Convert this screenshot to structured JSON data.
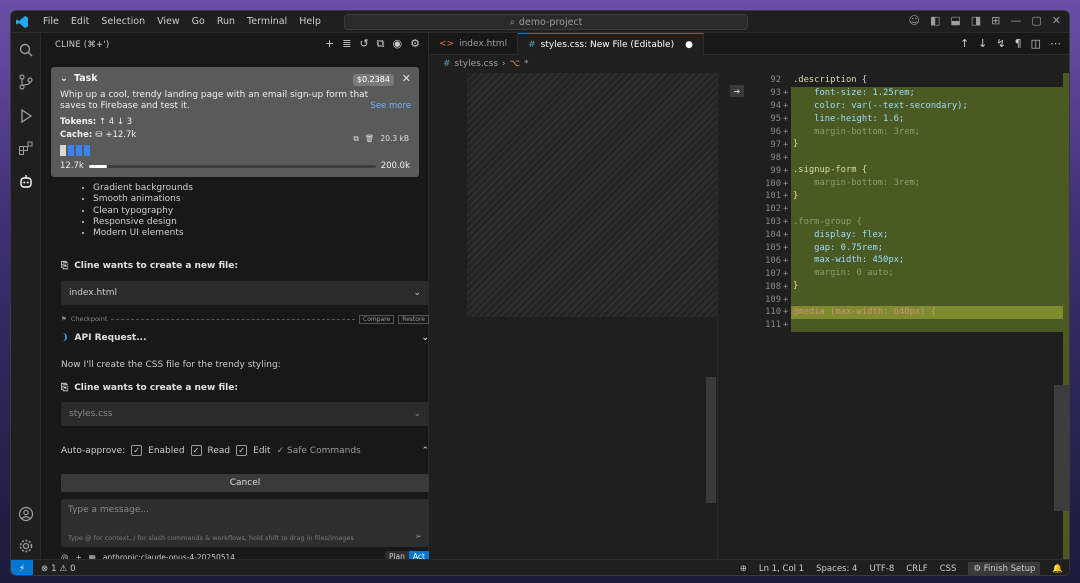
{
  "menu": [
    "File",
    "Edit",
    "Selection",
    "View",
    "Go",
    "Run",
    "Terminal",
    "Help"
  ],
  "search": {
    "text": "demo-project"
  },
  "sidebar": {
    "title": "CLINE (⌘+')"
  },
  "task": {
    "label": "Task",
    "cost": "$0.2384",
    "description": "Whip up a cool, trendy landing page with an email sign-up form that saves to Firebase and test it.",
    "see_more": "See more",
    "tokens_label": "Tokens:",
    "tokens_up": "4",
    "tokens_down": "3",
    "cache_label": "Cache:",
    "cache_value": "+12.7k",
    "cache_size": "20.3 kB",
    "context_used": "12.7k",
    "context_max": "200.0k",
    "context_fraction": 0.0635
  },
  "features": [
    "Gradient backgrounds",
    "Smooth animations",
    "Clean typography",
    "Responsive design",
    "Modern UI elements"
  ],
  "ask1": {
    "label": "Cline wants to create a new file:",
    "file": "index.html"
  },
  "checkpoint": {
    "label": "Checkpoint",
    "compare": "Compare",
    "restore": "Restore"
  },
  "api": {
    "label": "API Request..."
  },
  "now_text": "Now I'll create the CSS file for the trendy styling:",
  "ask2": {
    "label": "Cline wants to create a new file:",
    "file": "styles.css"
  },
  "auto": {
    "label": "Auto-approve:",
    "enabled": "Enabled",
    "read": "Read",
    "edit": "Edit",
    "safe": "✓ Safe Commands"
  },
  "cancel": "Cancel",
  "message": {
    "placeholder": "Type a message...",
    "hint": "Type @ for context, / for slash commands & workflows, hold shift to drag in files/images"
  },
  "footer": {
    "model": "anthropic:claude-opus-4-20250514",
    "plan": "Plan",
    "act": "Act"
  },
  "tabs": [
    {
      "label": "index.html",
      "icon": "<>"
    },
    {
      "label": "styles.css: New File (Editable)",
      "icon": "#"
    }
  ],
  "breadcrumb": {
    "file": "styles.css",
    "symbol": "*"
  },
  "code": [
    {
      "n": "92",
      "t": "sel",
      "c": ".description {",
      "mark": "",
      "kind": ""
    },
    {
      "n": "93",
      "t": "prop",
      "c": "    font-size: 1.25rem;",
      "mark": "+",
      "kind": "add"
    },
    {
      "n": "94",
      "t": "prop",
      "c": "    color: var(--text-secondary);",
      "mark": "+",
      "kind": "add"
    },
    {
      "n": "95",
      "t": "prop",
      "c": "    line-height: 1.6;",
      "mark": "+",
      "kind": "add"
    },
    {
      "n": "96",
      "t": "dim",
      "c": "    margin-bottom: 3rem;",
      "mark": "+",
      "kind": "add"
    },
    {
      "n": "97",
      "t": "sel",
      "c": "}",
      "mark": "+",
      "kind": "add"
    },
    {
      "n": "98",
      "t": "sel",
      "c": "",
      "mark": "+",
      "kind": "add"
    },
    {
      "n": "99",
      "t": "sel",
      "c": ".signup-form {",
      "mark": "+",
      "kind": "add"
    },
    {
      "n": "100",
      "t": "dim",
      "c": "    margin-bottom: 3rem;",
      "mark": "+",
      "kind": "add"
    },
    {
      "n": "101",
      "t": "sel",
      "c": "}",
      "mark": "+",
      "kind": "add"
    },
    {
      "n": "102",
      "t": "sel",
      "c": "",
      "mark": "+",
      "kind": "add"
    },
    {
      "n": "103",
      "t": "dim",
      "c": ".form-group {",
      "mark": "+",
      "kind": "add"
    },
    {
      "n": "104",
      "t": "prop",
      "c": "    display: flex;",
      "mark": "+",
      "kind": "add"
    },
    {
      "n": "105",
      "t": "prop",
      "c": "    gap: 0.75rem;",
      "mark": "+",
      "kind": "add"
    },
    {
      "n": "106",
      "t": "prop",
      "c": "    max-width: 450px;",
      "mark": "+",
      "kind": "add"
    },
    {
      "n": "107",
      "t": "dim",
      "c": "    margin: 0 auto;",
      "mark": "+",
      "kind": "add"
    },
    {
      "n": "108",
      "t": "sel",
      "c": "}",
      "mark": "+",
      "kind": "add"
    },
    {
      "n": "109",
      "t": "sel",
      "c": "",
      "mark": "+",
      "kind": "add"
    },
    {
      "n": "110",
      "t": "val",
      "c": "@media (max-width: 640px) {",
      "mark": "+",
      "kind": "hl"
    },
    {
      "n": "111",
      "t": "sel",
      "c": "",
      "mark": "+",
      "kind": "add"
    }
  ],
  "status": {
    "errors": "1",
    "warnings": "0",
    "position": "Ln 1, Col 1",
    "spaces": "Spaces: 4",
    "encoding": "UTF-8",
    "eol": "CRLF",
    "lang": "CSS",
    "finish": "Finish Setup"
  },
  "colors": {
    "accent": "#0078d4",
    "diff_add": "#4b5a22",
    "diff_highlight": "#7e8b2e"
  }
}
